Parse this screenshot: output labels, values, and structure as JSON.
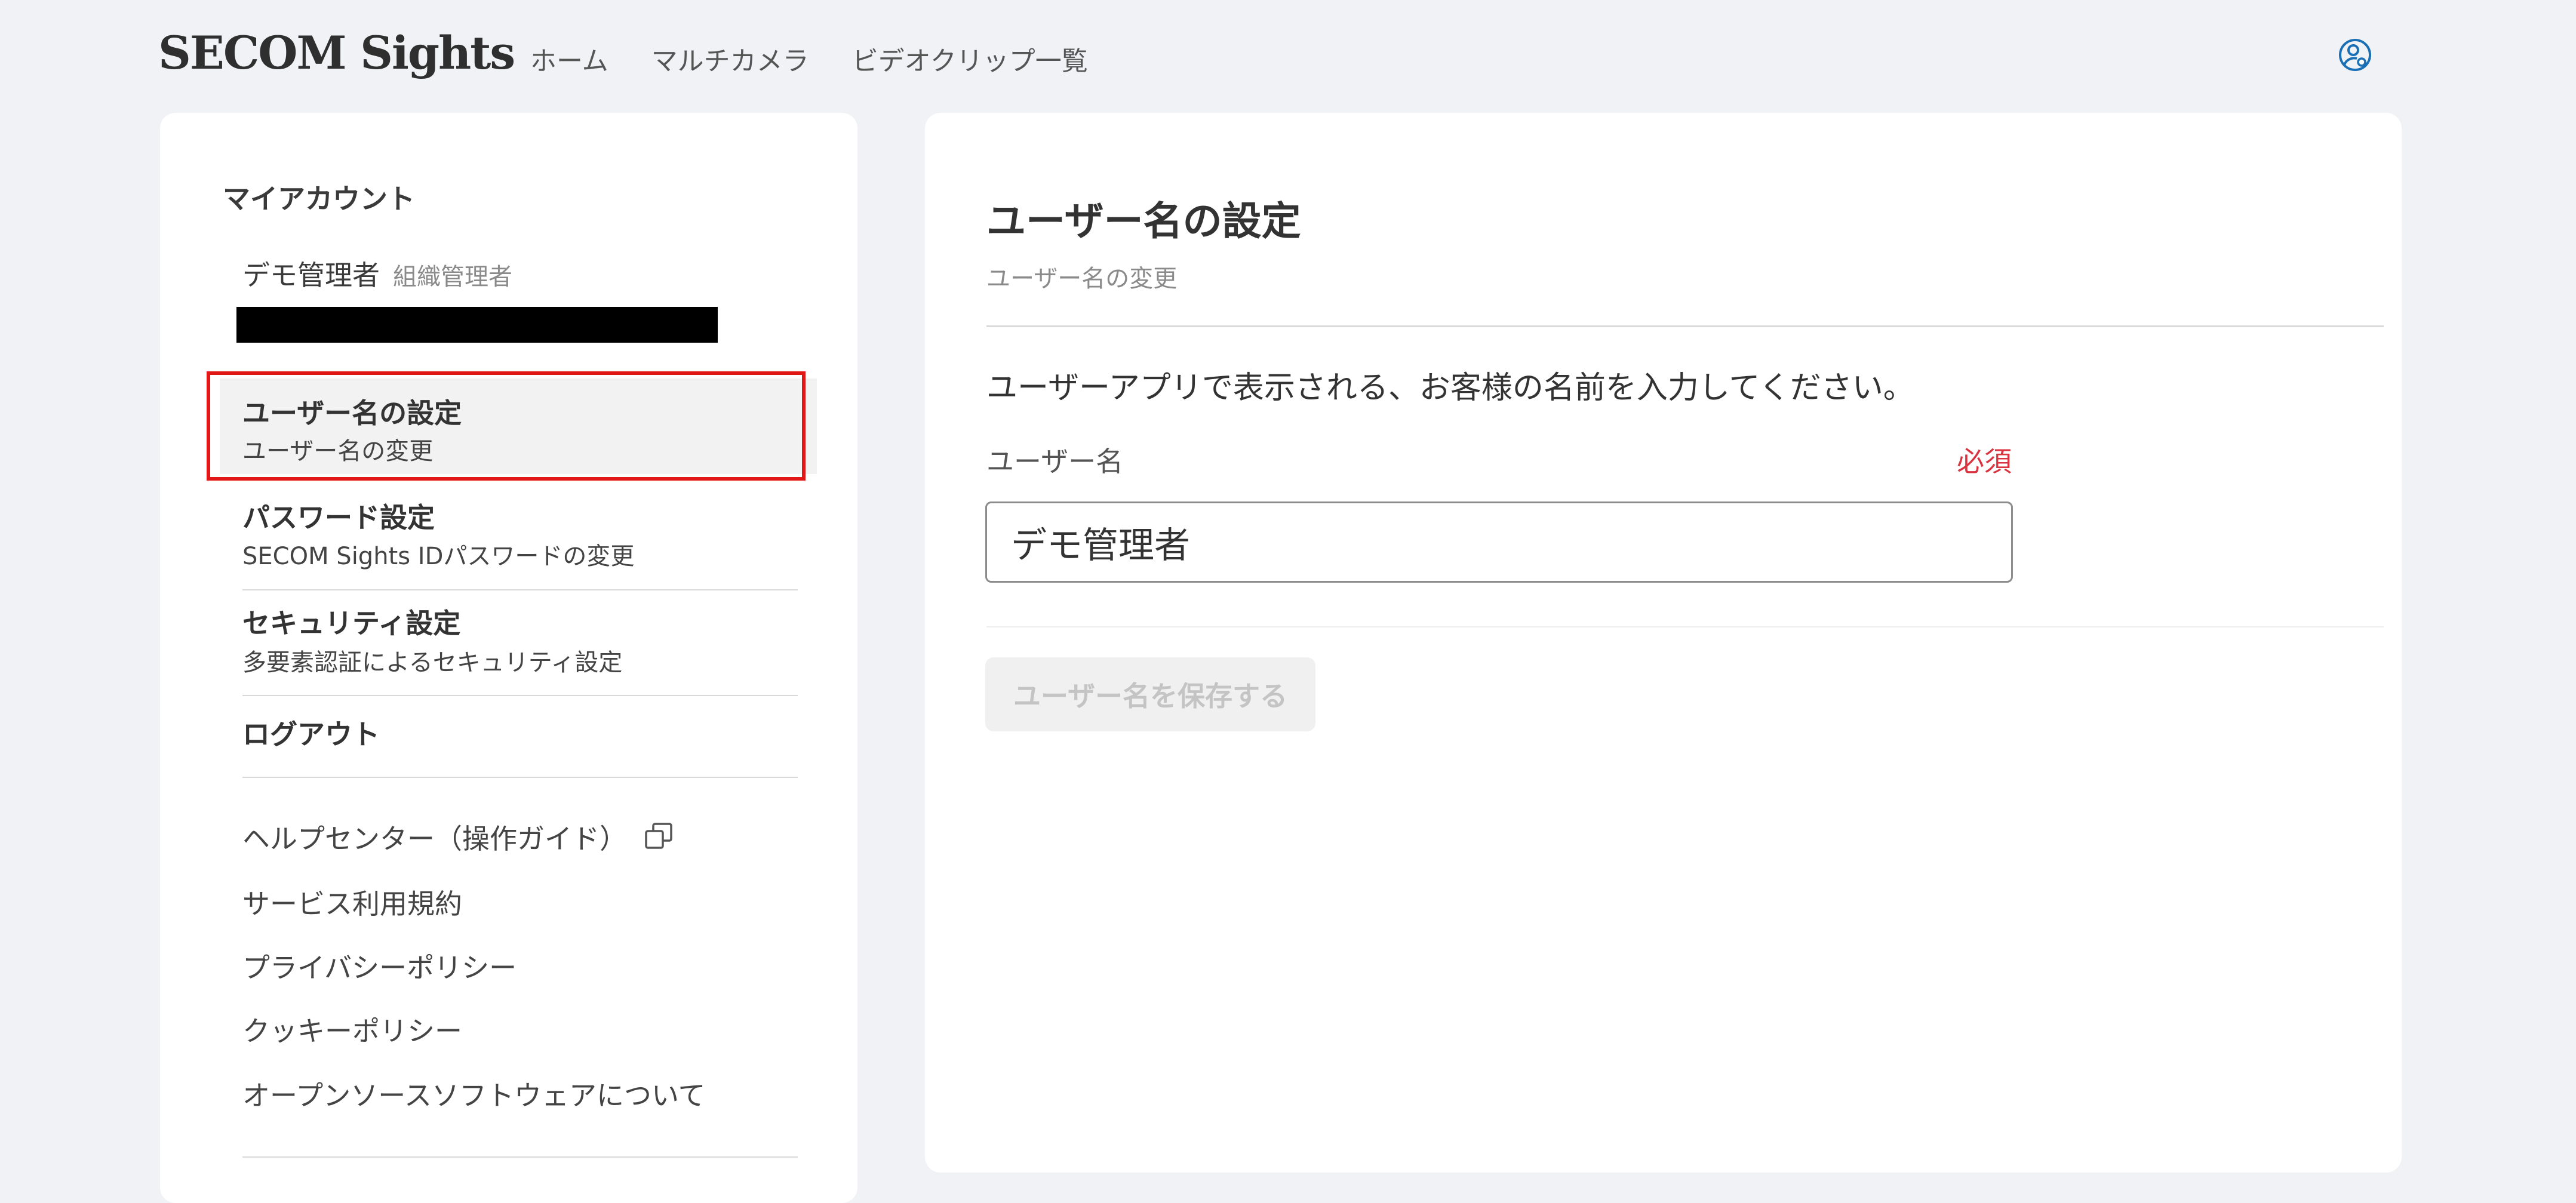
{
  "header": {
    "logo": "SECOM Sights",
    "nav": [
      "ホーム",
      "マルチカメラ",
      "ビデオクリップ一覧"
    ],
    "user_icon": "user-settings-icon",
    "accent_color": "#1a6fb5"
  },
  "sidebar": {
    "heading": "マイアカウント",
    "account_name": "デモ管理者",
    "account_role": "組織管理者",
    "menu": [
      {
        "title": "ユーザー名の設定",
        "subtitle": "ユーザー名の変更",
        "active": true
      },
      {
        "title": "パスワード設定",
        "subtitle": "SECOM Sights IDパスワードの変更"
      },
      {
        "title": "セキュリティ設定",
        "subtitle": "多要素認証によるセキュリティ設定"
      },
      {
        "title": "ログアウト"
      }
    ],
    "links": [
      {
        "label": "ヘルプセンター（操作ガイド）",
        "icon": "external-link-icon"
      },
      {
        "label": "サービス利用規約"
      },
      {
        "label": "プライバシーポリシー"
      },
      {
        "label": "クッキーポリシー"
      },
      {
        "label": "オープンソースソフトウェアについて"
      }
    ]
  },
  "main": {
    "title": "ユーザー名の設定",
    "subtitle": "ユーザー名の変更",
    "description": "ユーザーアプリで表示される、お客様の名前を入力してください。",
    "field_label": "ユーザー名",
    "required_label": "必須",
    "required_color": "#d9333f",
    "username_value": "デモ管理者",
    "save_label": "ユーザー名を保存する"
  }
}
